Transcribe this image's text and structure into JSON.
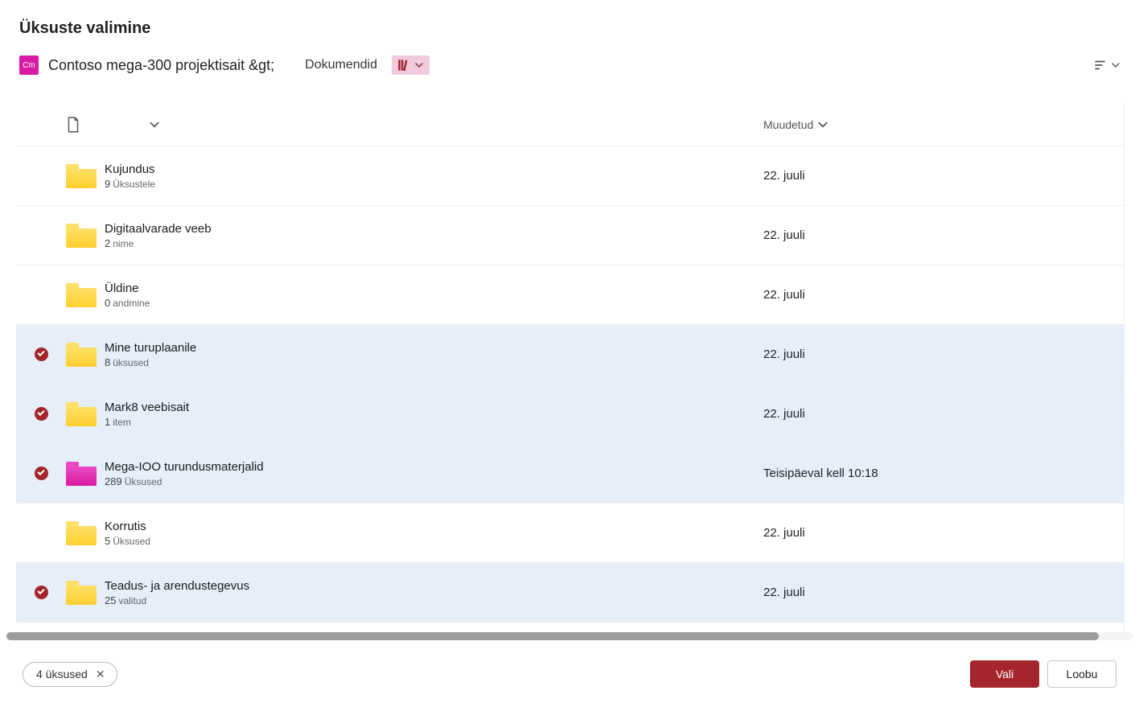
{
  "title": "Üksuste valimine",
  "breadcrumb": {
    "site_logo_abbrev": "Cm",
    "site_name": "Contoso mega-300 projektisait &gt;",
    "tab_label": "Dokumendid"
  },
  "columns": {
    "name_chevron_aria": "sort",
    "modified_label": "Muudetud"
  },
  "items": [
    {
      "name": "Kujundus",
      "count": "9",
      "unit": "Üksustele",
      "date": "22. juuli",
      "selected": false,
      "folder_color": "yellow"
    },
    {
      "name": "Digitaalvarade veeb",
      "count": "2",
      "unit": "nime",
      "date": "22. juuli",
      "selected": false,
      "folder_color": "yellow"
    },
    {
      "name": "Üldine",
      "count": "0",
      "unit": "andmine",
      "date": "22. juuli",
      "selected": false,
      "folder_color": "yellow"
    },
    {
      "name": "Mine turuplaanile",
      "count": "8",
      "unit": "üksused",
      "date": "22. juuli",
      "selected": true,
      "folder_color": "yellow"
    },
    {
      "name": "Mark8 veebisait",
      "count": "1",
      "unit": "item",
      "date": "22. juuli",
      "selected": true,
      "folder_color": "yellow"
    },
    {
      "name": "Mega-IOO turundusmaterjalid",
      "count": "289",
      "unit": "Üksused",
      "date": "Teisipäeval kell 10:18",
      "selected": true,
      "folder_color": "pink"
    },
    {
      "name": "Korrutis",
      "count": "5",
      "unit": "Üksused",
      "date": "22. juuli",
      "selected": false,
      "folder_color": "yellow"
    },
    {
      "name": "Teadus- ja arendustegevus",
      "count": "25",
      "unit": "valitud",
      "date": "22. juuli",
      "selected": true,
      "folder_color": "yellow"
    }
  ],
  "footer": {
    "selection_label": "4 üksused",
    "primary_label": "Vali",
    "secondary_label": "Loobu"
  }
}
